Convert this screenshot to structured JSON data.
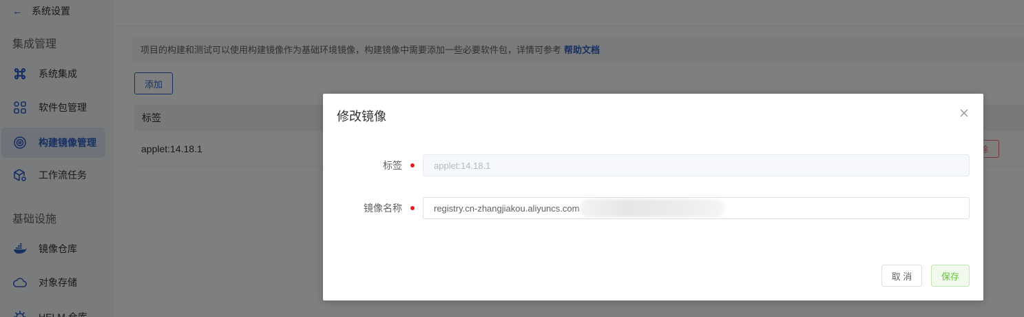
{
  "sidebar": {
    "back_label": "系统设置",
    "sections": [
      {
        "title": "集成管理"
      },
      {
        "title": "基础设施"
      }
    ],
    "items": [
      {
        "label": "系统集成",
        "icon": "command-icon",
        "active": false
      },
      {
        "label": "软件包管理",
        "icon": "grid-icon",
        "active": false
      },
      {
        "label": "构建镜像管理",
        "icon": "target-icon",
        "active": true
      },
      {
        "label": "工作流任务",
        "icon": "cube-gear-icon",
        "active": false
      },
      {
        "label": "镜像仓库",
        "icon": "docker-icon",
        "active": false
      },
      {
        "label": "对象存储",
        "icon": "cloud-icon",
        "active": false
      },
      {
        "label": "HELM 仓库",
        "icon": "helm-icon",
        "active": false
      }
    ]
  },
  "main": {
    "tip_text": "项目的构建和测试可以使用构建镜像作为基础环境镜像，构建镜像中需要添加一些必要软件包，详情可参考",
    "tip_link": "帮助文档",
    "add_button": "添加",
    "table": {
      "headers": [
        "标签"
      ],
      "rows": [
        {
          "tag": "applet:14.18.1",
          "action": "删除"
        }
      ]
    }
  },
  "dialog": {
    "title": "修改镜像",
    "fields": {
      "tag": {
        "label": "标签",
        "value": "applet:14.18.1"
      },
      "image_name": {
        "label": "镜像名称",
        "value": "registry.cn-zhangjiakou.aliyuncs.com"
      }
    },
    "cancel_label": "取 消",
    "save_label": "保存"
  },
  "colors": {
    "accent": "#2f5ec4",
    "danger": "#f56c6c",
    "success": "#67c23a",
    "required": "#e02020"
  }
}
